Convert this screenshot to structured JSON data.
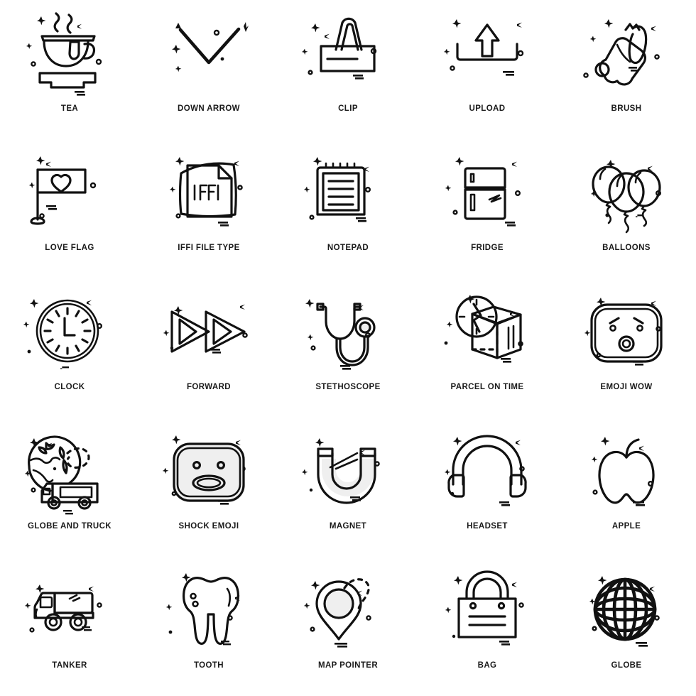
{
  "sheet": {
    "title": "Icon Set Sheet",
    "background_color": "#ffffff",
    "stroke_color": "#111111",
    "label_color": "#1a1a1a",
    "accent_gray": "#efefef",
    "columns": 5,
    "rows": 5,
    "total_icons": 25
  },
  "icons": [
    {
      "id": "tea",
      "label": "TEA",
      "icon_name": "tea-cup-icon"
    },
    {
      "id": "down-arrow",
      "label": "DOWN ARROW",
      "icon_name": "down-arrow-icon"
    },
    {
      "id": "clip",
      "label": "CLIP",
      "icon_name": "binder-clip-icon"
    },
    {
      "id": "upload",
      "label": "UPLOAD",
      "icon_name": "upload-icon"
    },
    {
      "id": "brush",
      "label": "BRUSH",
      "icon_name": "paint-brush-icon"
    },
    {
      "id": "love-flag",
      "label": "LOVE FLAG",
      "icon_name": "love-flag-icon"
    },
    {
      "id": "iffi-file-type",
      "label": "IFFI FILE TYPE",
      "icon_name": "iffi-file-icon",
      "file_text": "IFFI"
    },
    {
      "id": "notepad",
      "label": "NOTEPAD",
      "icon_name": "notepad-icon"
    },
    {
      "id": "fridge",
      "label": "FRIDGE",
      "icon_name": "fridge-icon"
    },
    {
      "id": "balloons",
      "label": "BALLOONS",
      "icon_name": "balloons-icon"
    },
    {
      "id": "clock",
      "label": "CLOCK",
      "icon_name": "clock-icon"
    },
    {
      "id": "forward",
      "label": "FORWARD",
      "icon_name": "fast-forward-icon"
    },
    {
      "id": "stethoscope",
      "label": "STETHOSCOPE",
      "icon_name": "stethoscope-icon"
    },
    {
      "id": "parcel-on-time",
      "label": "PARCEL ON TIME",
      "icon_name": "parcel-on-time-icon"
    },
    {
      "id": "emoji-wow",
      "label": "EMOJI WOW",
      "icon_name": "emoji-wow-icon"
    },
    {
      "id": "globe-and-truck",
      "label": "GLOBE AND TRUCK",
      "icon_name": "globe-and-truck-icon"
    },
    {
      "id": "shock-emoji",
      "label": "SHOCK EMOJI",
      "icon_name": "shock-emoji-icon"
    },
    {
      "id": "magnet",
      "label": "MAGNET",
      "icon_name": "magnet-icon"
    },
    {
      "id": "headset",
      "label": "HEADSET",
      "icon_name": "headset-icon"
    },
    {
      "id": "apple",
      "label": "APPLE",
      "icon_name": "apple-icon"
    },
    {
      "id": "tanker",
      "label": "TANKER",
      "icon_name": "tanker-truck-icon"
    },
    {
      "id": "tooth",
      "label": "TOOTH",
      "icon_name": "tooth-icon"
    },
    {
      "id": "map-pointer",
      "label": "MAP POINTER",
      "icon_name": "map-pointer-icon"
    },
    {
      "id": "bag",
      "label": "BAG",
      "icon_name": "shopping-bag-icon"
    },
    {
      "id": "globe",
      "label": "GLOBE",
      "icon_name": "globe-wireframe-icon"
    }
  ]
}
